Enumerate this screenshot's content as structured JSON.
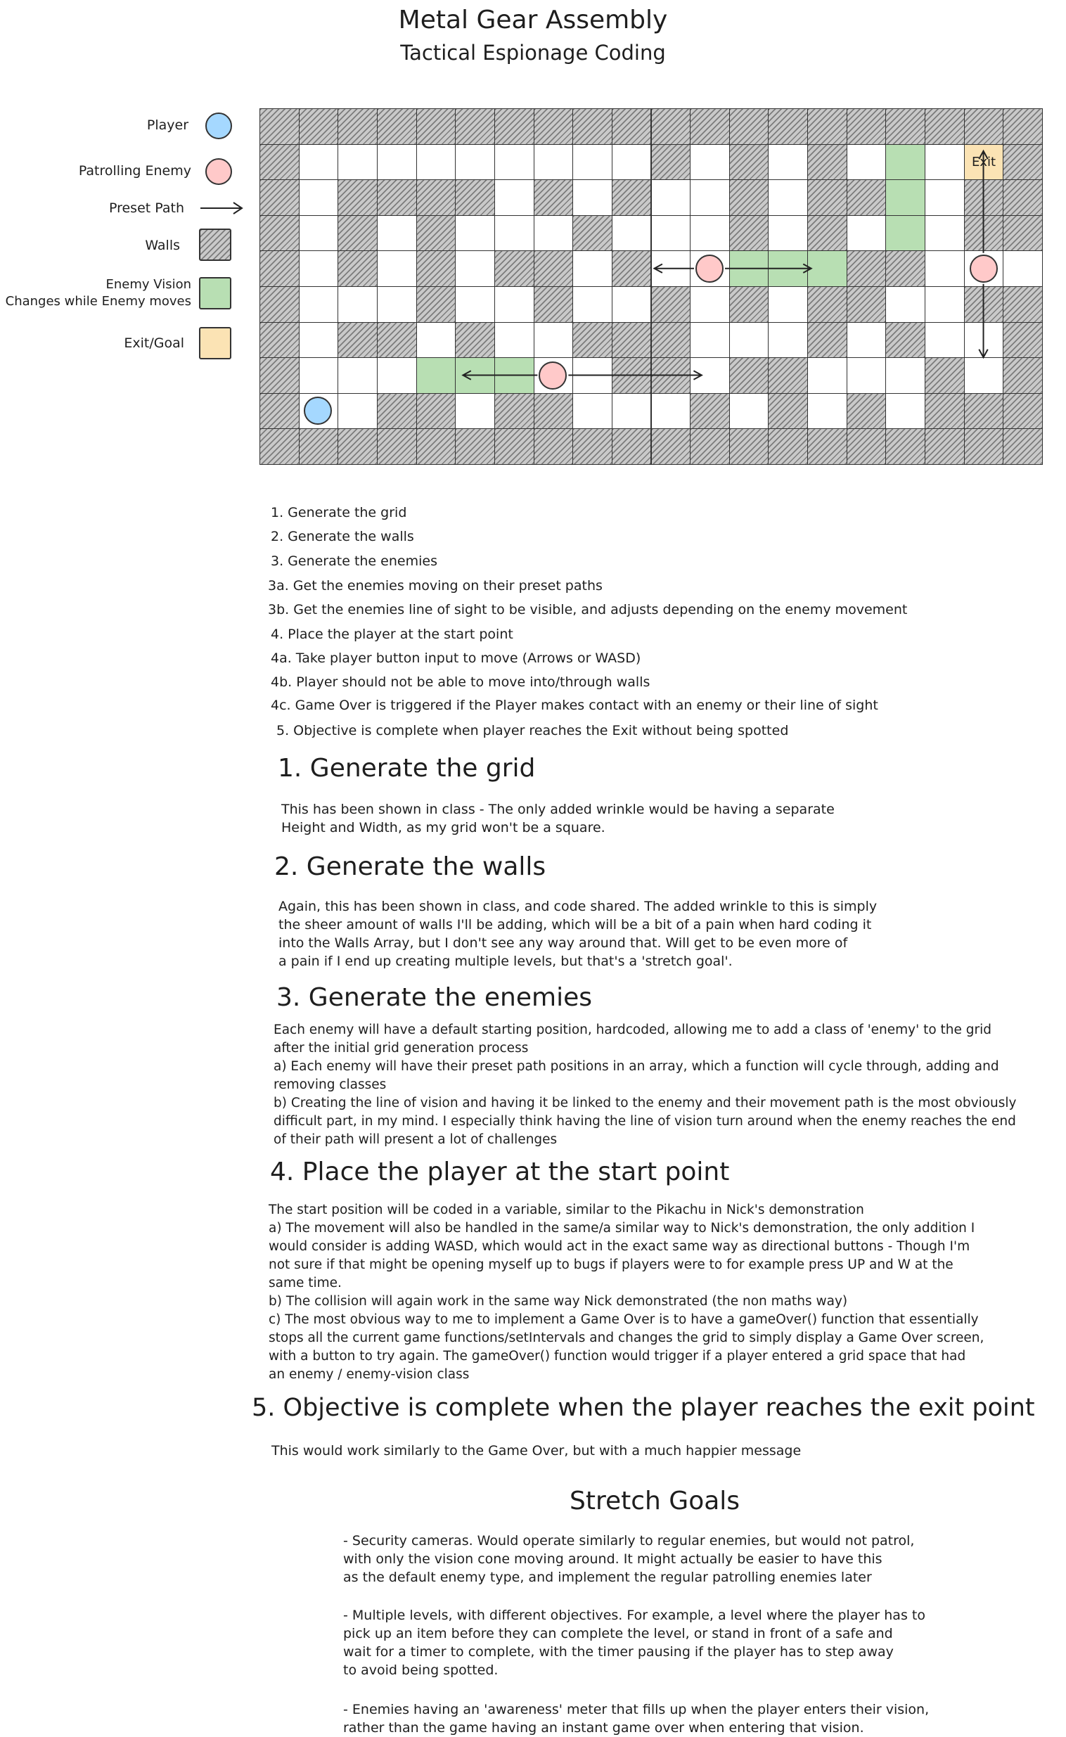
{
  "header": {
    "title": "Metal Gear Assembly",
    "subtitle": "Tactical Espionage Coding"
  },
  "legend": {
    "items": [
      {
        "label": "Player",
        "color": "#a5d8ff"
      },
      {
        "label": "Patrolling Enemy",
        "color": "#ffc9c9"
      },
      {
        "label": "Preset Path"
      },
      {
        "label": "Walls",
        "color": "#c9c9c9"
      },
      {
        "label": "Enemy Vision",
        "label2": "Changes while Enemy moves",
        "color": "#b2f2bb"
      },
      {
        "label": "Exit/Goal",
        "color": "#ffec99"
      }
    ]
  },
  "grid": {
    "cols": 20,
    "rows": 10,
    "exit_label": "Exit",
    "map": [
      "WWWWWWWWWWWWWWWWWWWW",
      "W.........W.W.W.V.XW",
      "W.WWWW.W.W..W.WWV.WW",
      "W.W.W...W...W.W.V.WW",
      "W.W.W.WW.W.EVVVWW.E.",
      "W...W..W..W.W.WW..WW",
      "W.WW.W..WWW...W.W..W",
      "W...VVVE.WW.WW...W.W",
      "WP.WW.WW...W.W.W.WWW",
      "WWWWWWWWWWWWWWWWWWWW"
    ]
  },
  "steps": [
    "1. Generate the grid",
    "2. Generate the walls",
    "3. Generate the enemies",
    "3a. Get the enemies moving on their preset paths",
    "3b. Get the enemies line of sight to be visible, and adjusts depending on the enemy movement",
    "4. Place the player at the start point",
    "4a. Take player button input to move (Arrows or WASD)",
    "4b. Player should not be able to move into/through walls",
    "4c. Game Over is triggered if the Player makes contact with an enemy or their line of sight",
    "5. Objective is complete when player reaches the Exit without being spotted"
  ],
  "sections": {
    "s1": {
      "heading": "1. Generate the grid",
      "body": "This has been shown in class - The only added wrinkle would be having a separate\nHeight and Width, as my grid won't be a square."
    },
    "s2": {
      "heading": "2. Generate the walls",
      "body": "Again, this has been shown in class, and code shared. The added wrinkle to this is simply\nthe sheer amount of walls I'll be adding, which will be a bit of a pain when hard coding it\ninto the Walls Array, but I don't see any way around that. Will get to be even more of\na pain if I end up creating multiple levels, but that's a 'stretch goal'."
    },
    "s3": {
      "heading": "3. Generate the enemies",
      "body": "Each enemy will have a default starting position, hardcoded, allowing me to add a class of 'enemy' to the grid\nafter the initial grid generation process\na) Each enemy will have their preset path positions in an array, which a function will cycle through, adding and\nremoving classes\nb) Creating the line of vision and having it be linked to the enemy and their movement path is the most obviously\ndifficult part, in my mind. I especially think having the line of vision turn around when the enemy reaches the end\nof their path will present a lot of challenges"
    },
    "s4": {
      "heading": "4. Place the player at the start point",
      "body": "The start position will be coded in a variable, similar to the Pikachu in Nick's demonstration\na) The movement will also be handled in the same/a similar way to Nick's demonstration, the only addition I\nwould consider is adding WASD, which would act in the exact same way as directional buttons - Though I'm\nnot sure if that might be opening myself up to bugs if players were to for example press UP and W at the\nsame time.\nb) The collision will again work in the same way Nick demonstrated (the non maths way)\nc) The most obvious way to me to implement a Game Over is to have a gameOver() function that essentially\nstops all the current game functions/setIntervals and changes the grid to simply display a Game Over screen,\nwith a button to try again. The gameOver() function would trigger if a player entered a grid space that had\nan enemy / enemy-vision class"
    },
    "s5": {
      "heading": "5. Objective is complete when the player reaches the exit point",
      "body": "This would work similarly to the Game Over, but with a much happier message"
    }
  },
  "stretch": {
    "heading": "Stretch Goals",
    "items": [
      "- Security cameras. Would operate similarly to regular enemies, but would not patrol,\n  with only the vision cone moving around. It might actually be easier to have this\n  as the default enemy type, and implement the regular patrolling enemies later",
      "- Multiple levels, with different objectives. For example, a level where the player has to\n  pick up an item before they can complete the level, or stand in front of a safe and\n  wait for a timer to complete, with the timer pausing if the player has to step away\n  to avoid being spotted.",
      "- Enemies having an 'awareness' meter that fills up when the player enters their vision,\n  rather than the game having an instant game over when entering that vision."
    ]
  }
}
